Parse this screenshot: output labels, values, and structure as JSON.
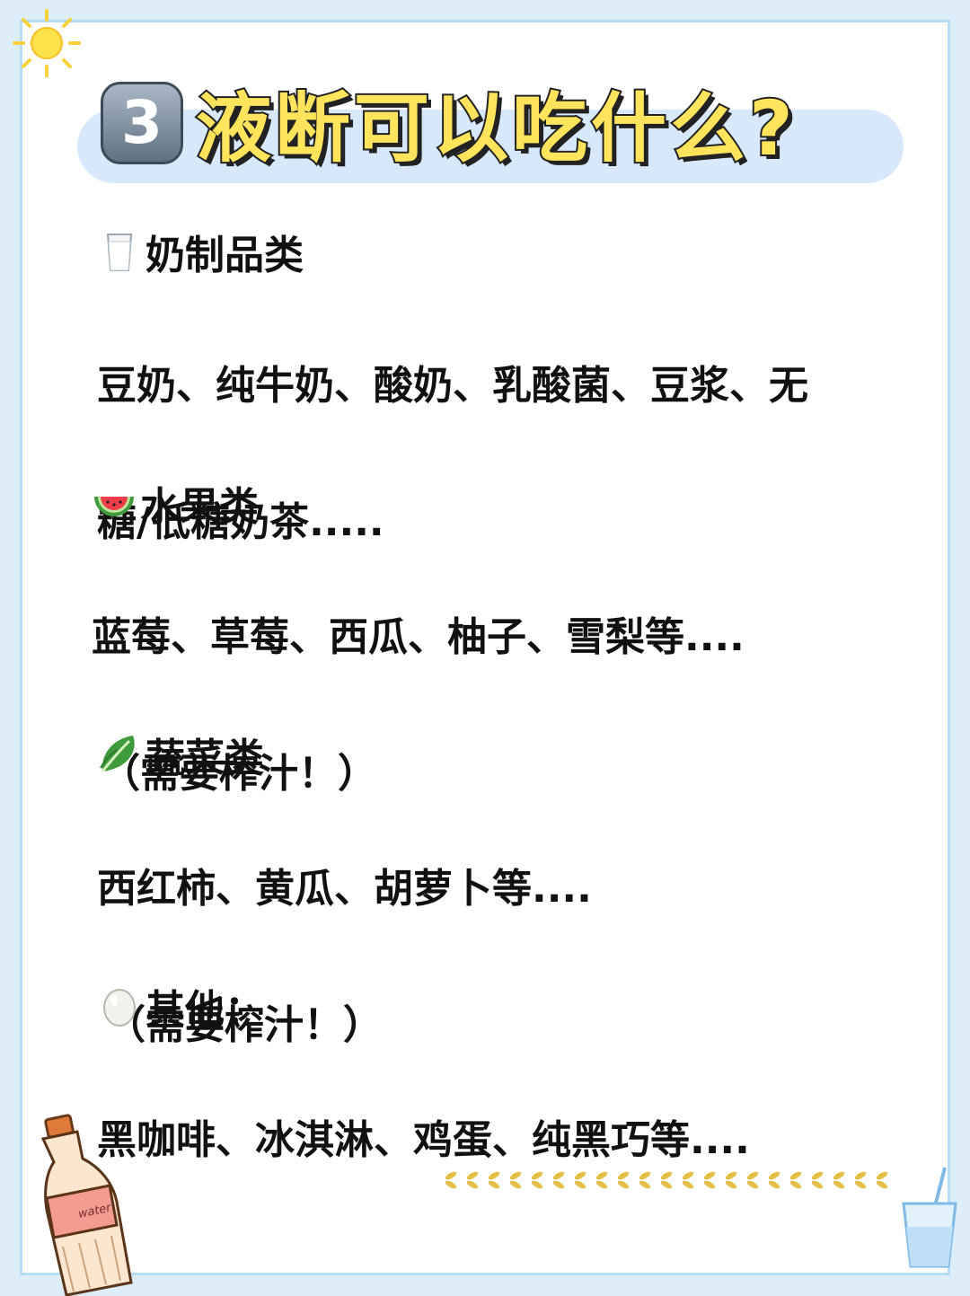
{
  "title": {
    "badge": "3",
    "text": "液断可以吃什么?"
  },
  "sections": [
    {
      "icon": "milk-glass-icon",
      "heading": "奶制品类",
      "lines": [
        "豆奶、纯牛奶、酸奶、乳酸菌、豆浆、无",
        "糖/低糖奶茶....."
      ],
      "note": ""
    },
    {
      "icon": "watermelon-icon",
      "heading": "水果类",
      "lines": [
        "蓝莓、草莓、西瓜、柚子、雪梨等...."
      ],
      "note": "（需要榨汁！）"
    },
    {
      "icon": "leafy-greens-icon",
      "heading": "蔬菜类",
      "lines": [
        "西红柿、黄瓜、胡萝卜等...."
      ],
      "note": "（需要榨汁！）"
    },
    {
      "icon": "egg-icon",
      "heading": "其他：",
      "lines": [
        "黑咖啡、冰淇淋、鸡蛋、纯黑巧等...."
      ],
      "note": ""
    }
  ],
  "decor": {
    "bottle_label": "water"
  },
  "colors": {
    "page_border": "#b6dcf6",
    "title_fill": "#ffe45c",
    "title_pill": "#d7e8fb"
  }
}
